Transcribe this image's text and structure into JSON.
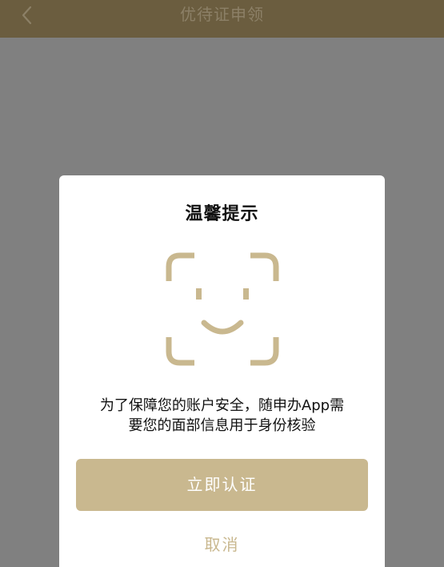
{
  "nav": {
    "title": "优待证申领",
    "back_icon": "chevron-left-icon"
  },
  "dialog": {
    "title": "温馨提示",
    "icon": "face-scan-icon",
    "message_line1": "为了保障您的账户安全，随申办App需",
    "message_line2": "要您的面部信息用于身份核验",
    "confirm_label": "立即认证",
    "cancel_label": "取消"
  },
  "colors": {
    "navbar_bg": "#6b5d3f",
    "overlay": "#808080",
    "accent_gold": "#c9b88f",
    "dialog_bg": "#ffffff"
  }
}
